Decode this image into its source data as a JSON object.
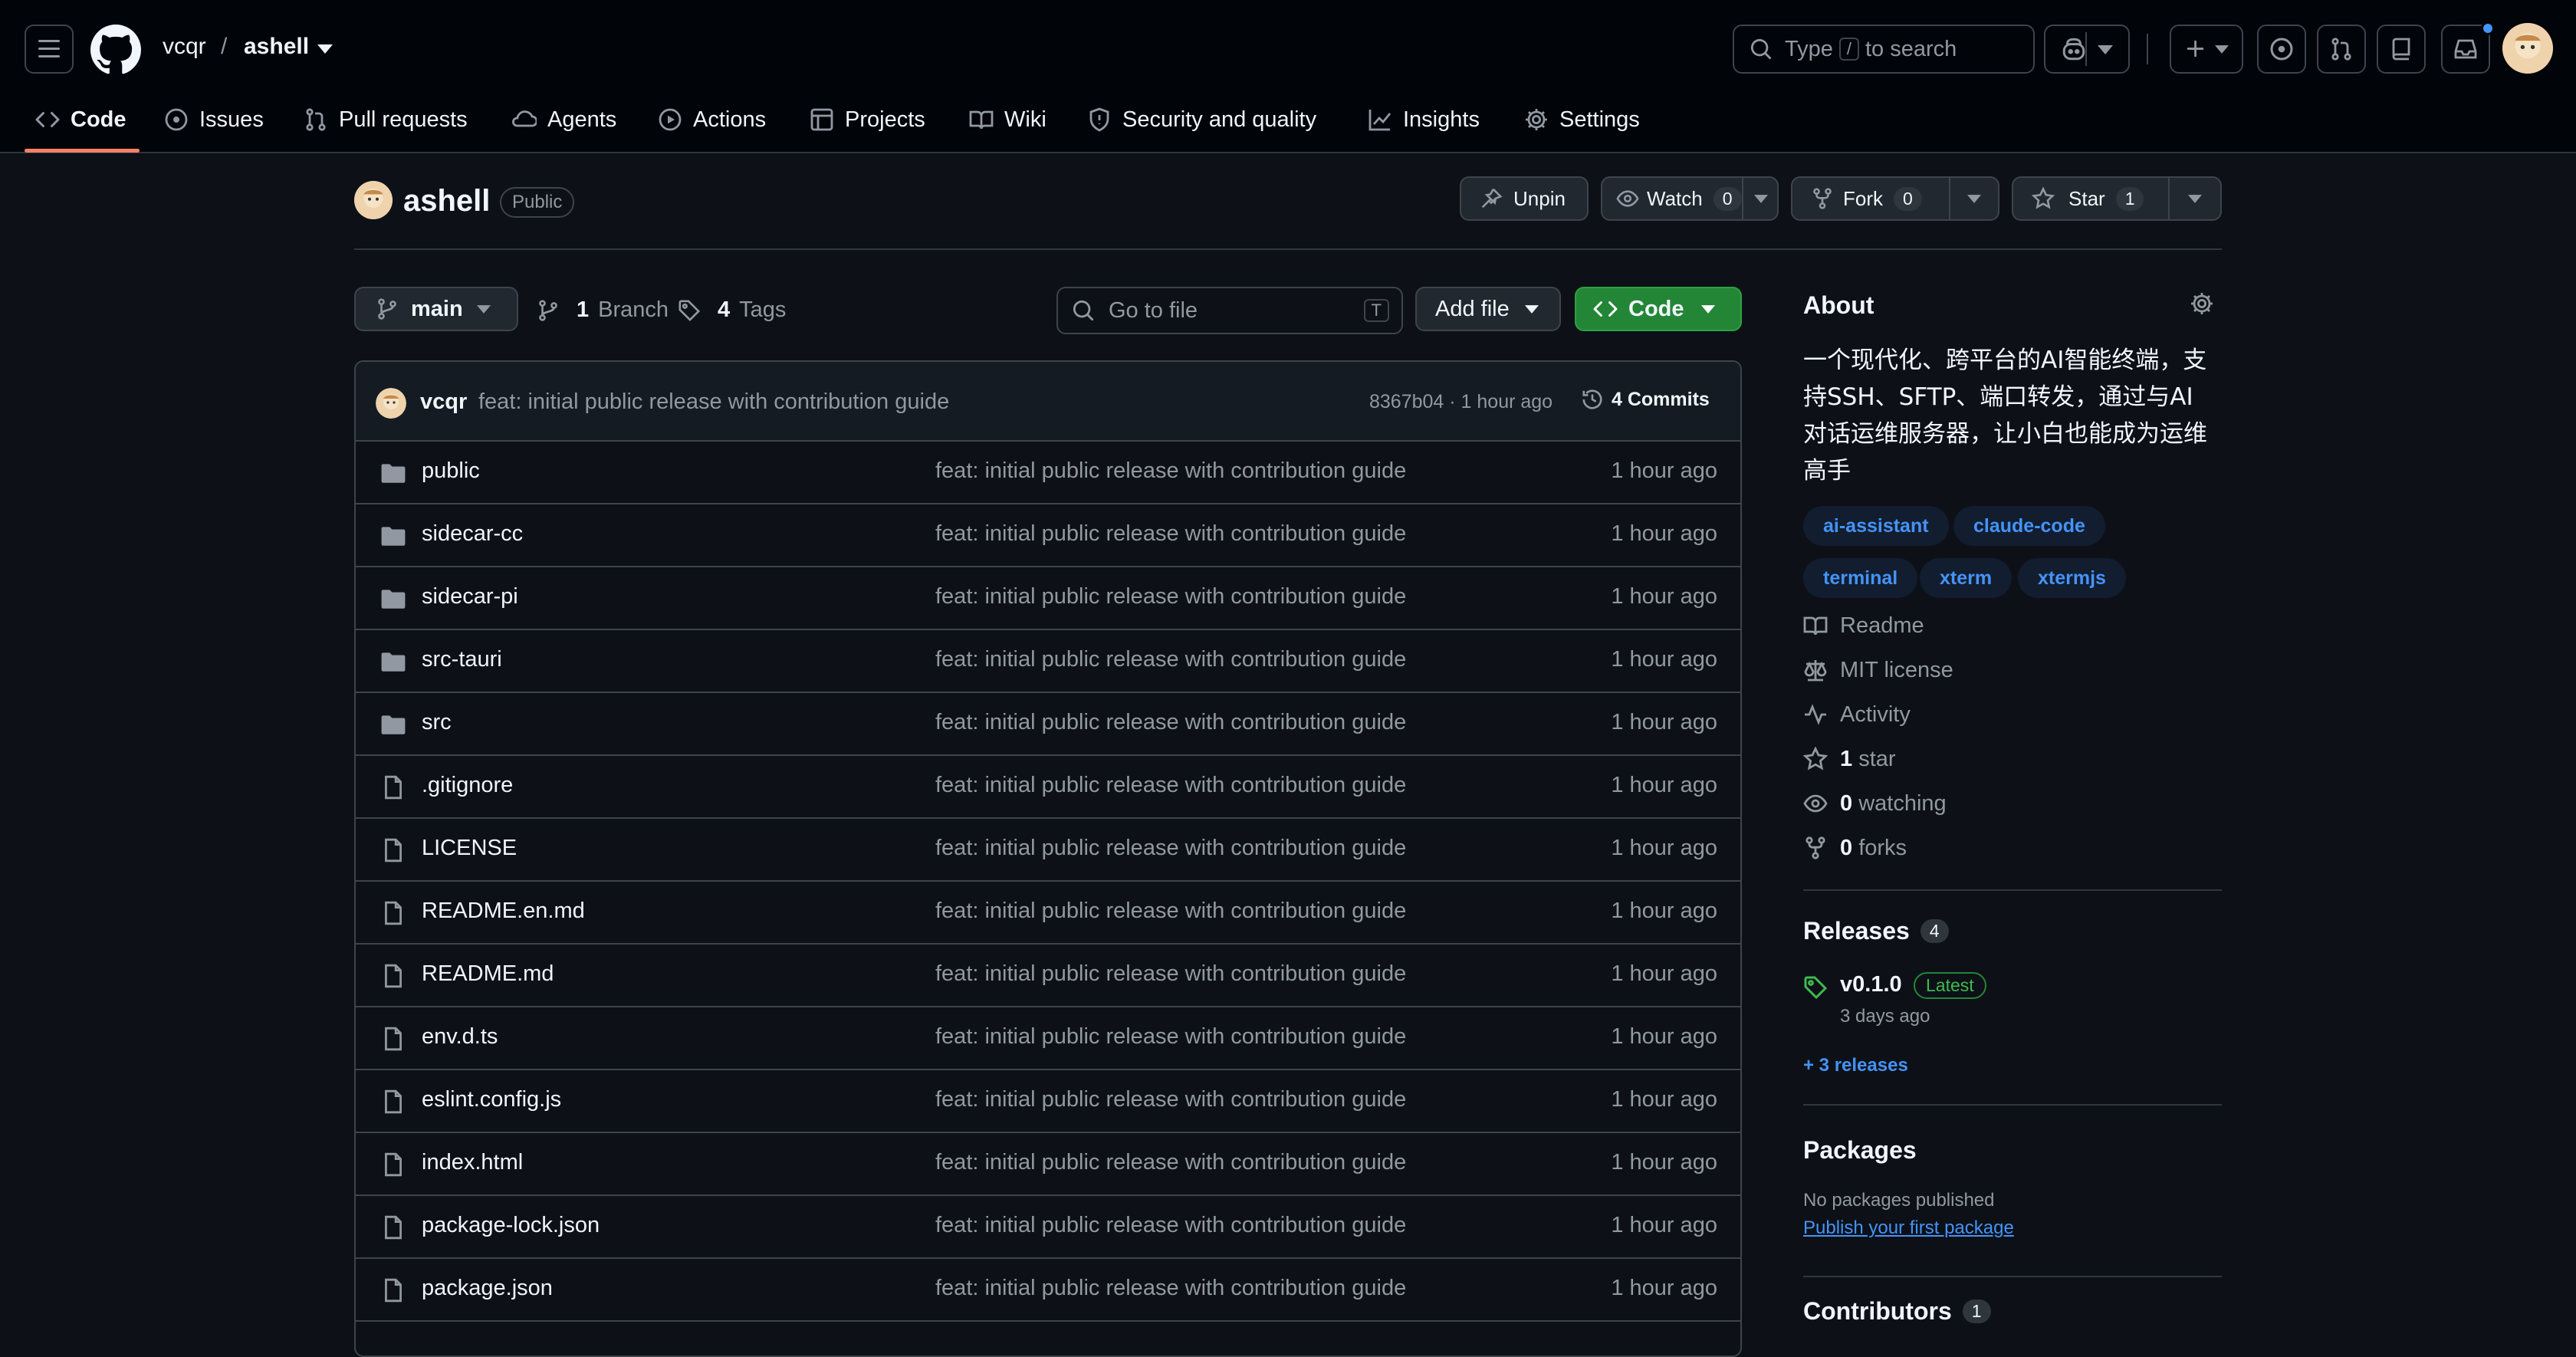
{
  "header": {
    "owner": "vcqr",
    "separator": "/",
    "repo": "ashell",
    "search_prefix": "Type",
    "search_key": "/",
    "search_suffix": "to search",
    "nav": [
      {
        "label": "Code",
        "icon": "code-icon"
      },
      {
        "label": "Issues",
        "icon": "issue-icon"
      },
      {
        "label": "Pull requests",
        "icon": "pull-request-icon"
      },
      {
        "label": "Agents",
        "icon": "agents-icon"
      },
      {
        "label": "Actions",
        "icon": "play-icon"
      },
      {
        "label": "Projects",
        "icon": "table-icon"
      },
      {
        "label": "Wiki",
        "icon": "book-icon"
      },
      {
        "label": "Security and quality",
        "icon": "shield-icon"
      },
      {
        "label": "Insights",
        "icon": "graph-icon"
      },
      {
        "label": "Settings",
        "icon": "gear-icon"
      }
    ]
  },
  "repo": {
    "name": "ashell",
    "visibility": "Public",
    "unpin": "Unpin",
    "watch": "Watch",
    "watch_count": "0",
    "fork": "Fork",
    "fork_count": "0",
    "star": "Star",
    "star_count": "1"
  },
  "toolbar": {
    "branch": "main",
    "branch_count": "1",
    "branch_label": "Branch",
    "tag_count": "4",
    "tag_label": "Tags",
    "goto_placeholder": "Go to file",
    "goto_key": "T",
    "add_file": "Add file",
    "code": "Code"
  },
  "commit": {
    "author": "vcqr",
    "message": "feat: initial public release with contribution guide",
    "sha_time": "8367b04 · 1 hour ago",
    "commits": "4 Commits"
  },
  "files": [
    {
      "name": "public",
      "type": "dir",
      "message": "feat: initial public release with contribution guide",
      "time": "1 hour ago"
    },
    {
      "name": "sidecar-cc",
      "type": "dir",
      "message": "feat: initial public release with contribution guide",
      "time": "1 hour ago"
    },
    {
      "name": "sidecar-pi",
      "type": "dir",
      "message": "feat: initial public release with contribution guide",
      "time": "1 hour ago"
    },
    {
      "name": "src-tauri",
      "type": "dir",
      "message": "feat: initial public release with contribution guide",
      "time": "1 hour ago"
    },
    {
      "name": "src",
      "type": "dir",
      "message": "feat: initial public release with contribution guide",
      "time": "1 hour ago"
    },
    {
      "name": ".gitignore",
      "type": "file",
      "message": "feat: initial public release with contribution guide",
      "time": "1 hour ago"
    },
    {
      "name": "LICENSE",
      "type": "file",
      "message": "feat: initial public release with contribution guide",
      "time": "1 hour ago"
    },
    {
      "name": "README.en.md",
      "type": "file",
      "message": "feat: initial public release with contribution guide",
      "time": "1 hour ago"
    },
    {
      "name": "README.md",
      "type": "file",
      "message": "feat: initial public release with contribution guide",
      "time": "1 hour ago"
    },
    {
      "name": "env.d.ts",
      "type": "file",
      "message": "feat: initial public release with contribution guide",
      "time": "1 hour ago"
    },
    {
      "name": "eslint.config.js",
      "type": "file",
      "message": "feat: initial public release with contribution guide",
      "time": "1 hour ago"
    },
    {
      "name": "index.html",
      "type": "file",
      "message": "feat: initial public release with contribution guide",
      "time": "1 hour ago"
    },
    {
      "name": "package-lock.json",
      "type": "file",
      "message": "feat: initial public release with contribution guide",
      "time": "1 hour ago"
    },
    {
      "name": "package.json",
      "type": "file",
      "message": "feat: initial public release with contribution guide",
      "time": "1 hour ago"
    }
  ],
  "about": {
    "title": "About",
    "description_lines": [
      "一个现代化、跨平台的AI智能终端，支",
      "持SSH、SFTP、端口转发，通过与AI",
      "对话运维服务器，让小白也能成为运维",
      "高手"
    ],
    "topics": [
      "ai-assistant",
      "claude-code",
      "terminal",
      "xterm",
      "xtermjs"
    ],
    "readme": "Readme",
    "license": "MIT license",
    "activity": "Activity",
    "stars_count": "1",
    "stars_label": "star",
    "watching_count": "0",
    "watching_label": "watching",
    "forks_count": "0",
    "forks_label": "forks"
  },
  "releases": {
    "title": "Releases",
    "count": "4",
    "latest_version": "v0.1.0",
    "latest_badge": "Latest",
    "latest_date": "3 days ago",
    "more": "+ 3 releases"
  },
  "packages": {
    "title": "Packages",
    "none": "No packages published",
    "publish_link": "Publish your first package"
  },
  "contributors": {
    "title": "Contributors",
    "count": "1"
  },
  "colors": {
    "background": "#0d1117",
    "header": "#010409",
    "accent_link": "#4493f8",
    "primary_button": "#238636",
    "underline": "#f78166",
    "latest_badge": "#3fb950"
  }
}
